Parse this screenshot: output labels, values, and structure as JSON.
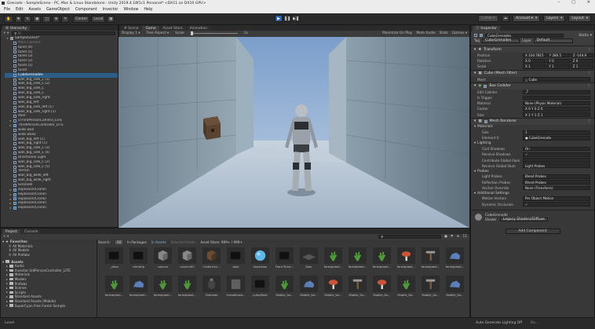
{
  "window": {
    "title": "Grenade - SampleScene - PC, Mac & Linux Standalone - Unity 2019.4.18f1c1 Personal* <DX11 on DX10 GPU>",
    "min": "–",
    "max": "□",
    "close": "✕"
  },
  "menu": [
    "File",
    "Edit",
    "Assets",
    "GameObject",
    "Component",
    "Invector",
    "Window",
    "Help"
  ],
  "toolbar": {
    "pivot": "Center",
    "space": "Local",
    "collab": "Collab ▾",
    "account": "Account ▾",
    "layers": "Layers",
    "layout": "Layout"
  },
  "hierarchy": {
    "tab": "Hierarchy",
    "create": "+ ▾",
    "search_placeholder": "All",
    "scene": "SampleScene*",
    "items": [
      {
        "label": "Main Camera",
        "dim": true,
        "depth": 1
      },
      {
        "label": "tunel (4)",
        "depth": 1
      },
      {
        "label": "tunel (5)",
        "depth": 1
      },
      {
        "label": "tunel (3)",
        "depth": 1
      },
      {
        "label": "tunel (2)",
        "depth": 1
      },
      {
        "label": "tunel (1)",
        "depth": 1
      },
      {
        "label": "tunel",
        "depth": 1
      },
      {
        "label": "CubeGrenades",
        "sel": true,
        "depth": 1
      },
      {
        "label": "wall_big_side_L (1)",
        "depth": 1
      },
      {
        "label": "wall_big_side_L (2)",
        "depth": 1
      },
      {
        "label": "wall_big_side_L",
        "depth": 1
      },
      {
        "label": "wall_big_side_L",
        "depth": 1
      },
      {
        "label": "wall_big_side_right",
        "depth": 1
      },
      {
        "label": "wall_big_left",
        "depth": 1
      },
      {
        "label": "wall_big_side_left (1)",
        "depth": 1
      },
      {
        "label": "wall_big_side_right (1)",
        "depth": 1
      },
      {
        "label": "door",
        "depth": 1
      },
      {
        "label": "vThirdPersonCamera_LITE",
        "depth": 1,
        "arrow": true
      },
      {
        "label": "ThirdPersonController_LITE",
        "depth": 1,
        "arrow": true,
        "prefab": true
      },
      {
        "label": "wide wall",
        "depth": 1
      },
      {
        "label": "wide wall2",
        "depth": 1
      },
      {
        "label": "wall_big_left (1)",
        "depth": 1
      },
      {
        "label": "wall_big_right (1)",
        "depth": 1
      },
      {
        "label": "wall_big_side_L (3)",
        "depth": 1
      },
      {
        "label": "wall_big_side_L (4)",
        "depth": 1
      },
      {
        "label": "Directional Light",
        "depth": 1
      },
      {
        "label": "wall_big_side_L (2)",
        "depth": 1
      },
      {
        "label": "wall_big_side_L (5)",
        "depth": 1
      },
      {
        "label": "Terrain",
        "depth": 1
      },
      {
        "label": "wall_big_wide_left",
        "depth": 1
      },
      {
        "label": "wall_big_wide_right",
        "depth": 1
      },
      {
        "label": "Grenade",
        "depth": 1
      },
      {
        "label": "explosion(Clone)",
        "depth": 1,
        "arrow": true,
        "prefab": true
      },
      {
        "label": "explosion(Clone)",
        "depth": 1,
        "arrow": true,
        "prefab": true
      },
      {
        "label": "explosion(Clone)",
        "depth": 1,
        "arrow": true,
        "prefab": true
      },
      {
        "label": "explosion(Clone)",
        "depth": 1,
        "arrow": true,
        "prefab": true
      },
      {
        "label": "explosion(Clone)",
        "depth": 1,
        "arrow": true,
        "prefab": true
      }
    ]
  },
  "scene_view": {
    "tabs": [
      "# Scene",
      "Game",
      "Asset Store",
      "Animation"
    ],
    "display": "Display 1 ▾",
    "aspect": "Free Aspect ▾",
    "scale_label": "Scale",
    "scale_value": "1x",
    "toggles": [
      "Maximize On Play",
      "Mute Audio",
      "Stats",
      "Gizmos ▾"
    ]
  },
  "inspector": {
    "tab": "Inspector",
    "object_name": "CubeGrenades",
    "static": "Static ▾",
    "tag_label": "Tag",
    "tag": "CubeGrenades",
    "layer_label": "Layer",
    "layer": "Default",
    "transform": {
      "title": "Transform",
      "rows": [
        {
          "label": "Position",
          "x": "X 334.7815",
          "y": "Y 280.5",
          "z": "Z -144.9"
        },
        {
          "label": "Rotation",
          "x": "X 0",
          "y": "Y 0",
          "z": "Z 0"
        },
        {
          "label": "Scale",
          "x": "X 1",
          "y": "Y 1",
          "z": "Z 1"
        }
      ]
    },
    "mesh_filter": {
      "title": "Cube (Mesh Filter)",
      "mesh_label": "Mesh",
      "mesh": "Cube"
    },
    "box_collider": {
      "title": "Box Collider",
      "rows": [
        {
          "label": "Edit Collider",
          "value": "⤴"
        },
        {
          "label": "Is Trigger",
          "value": ""
        },
        {
          "label": "Material",
          "value": "None (Physic Material)"
        },
        {
          "label": "Center",
          "value": "X 0   Y 0   Z 0"
        },
        {
          "label": "Size",
          "value": "X 1   Y 1   Z 1"
        }
      ]
    },
    "mesh_renderer": {
      "title": "Mesh Renderer",
      "materials": {
        "title": "Materials",
        "size_label": "Size",
        "size": "1",
        "element_label": "Element 0",
        "element": "CubeGrenade"
      },
      "lighting": {
        "title": "Lighting",
        "rows": [
          {
            "label": "Cast Shadows",
            "value": "On"
          },
          {
            "label": "Receive Shadows",
            "value": "✓"
          },
          {
            "label": "Contribute Global Illum",
            "value": ""
          },
          {
            "label": "Receive Global Illum",
            "value": "Light Probes"
          }
        ]
      },
      "probes": {
        "title": "Probes",
        "rows": [
          {
            "label": "Light Probes",
            "value": "Blend Probes"
          },
          {
            "label": "Reflection Probes",
            "value": "Blend Probes"
          },
          {
            "label": "Anchor Override",
            "value": "None (Transform)"
          }
        ]
      },
      "additional": {
        "title": "Additional Settings",
        "rows": [
          {
            "label": "Motion Vectors",
            "value": "Per Object Motion"
          },
          {
            "label": "Dynamic Occlusion",
            "value": "✓"
          }
        ]
      }
    },
    "material": {
      "name": "CubeGrenade",
      "shader_label": "Shader",
      "shader": "Legacy Shaders/Diffuse"
    },
    "add_component": "Add Component"
  },
  "project": {
    "tabs": [
      "Project",
      "Console"
    ],
    "create": "+ ▾",
    "search_tabs": [
      "Search:",
      "All",
      "In Packages",
      "In Assets",
      "Selected folder",
      "Asset Store: 999+ / 999+"
    ],
    "count": "11",
    "favorites": {
      "title": "Favorites",
      "items": [
        "All Materials",
        "All Models",
        "All Prefabs"
      ]
    },
    "assets": {
      "title": "Assets",
      "items": [
        "Audio",
        "Invector-3rdPersonController_LITE",
        "Materials",
        "Models",
        "Prefabs",
        "Scenes",
        "Scripts",
        "Standard Assets",
        "Standard Assets (Mobile)",
        "SuperCyan Free Forest Sample"
      ]
    },
    "grid_row1": [
      "_stars",
      "climbUp",
      "column",
      "column02",
      "CrateGren...",
      "door",
      "explosion",
      "Flare Picke...",
      "floor",
      "forestplant...",
      "forestplant...",
      "forestplant...",
      "forestplant...",
      "forestplant...",
      "forestplant..."
    ],
    "grid_row2": [
      "forestplant...",
      "forestplant...",
      "forestplant...",
      "forestplant...",
      "Grenade",
      "Invisiblewa...",
      "jumpStart",
      "Mobile_for...",
      "Mobile_for...",
      "Mobile_for...",
      "Mobile_for...",
      "Mobile_for...",
      "Mobile_for...",
      "Mobile_for...",
      "Mobile_for..."
    ],
    "icon_kinds1": [
      "dark",
      "dark",
      "cube",
      "cube",
      "box",
      "dark",
      "sphere",
      "dark",
      "plate",
      "plant",
      "plant",
      "plant",
      "mushroom",
      "tree",
      "rock"
    ],
    "icon_kinds2": [
      "plant",
      "rock",
      "plant",
      "plant",
      "grenade",
      "wall",
      "dark",
      "plant",
      "rock",
      "mushroom",
      "tree",
      "mushroom",
      "plant",
      "tree",
      "rock"
    ]
  },
  "status": {
    "left": "Leant",
    "right": "Auto Generate Lighting Off",
    "extra": "Ba..."
  }
}
